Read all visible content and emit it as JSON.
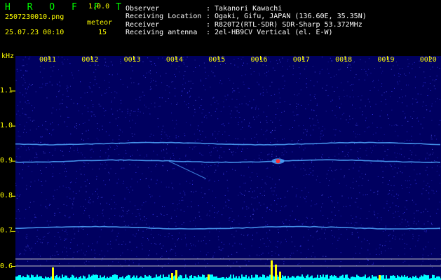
{
  "app": {
    "brand": "H R O F F T",
    "version": "1.0.0"
  },
  "file": {
    "filename": "2507230010.png",
    "datetime": "25.07.23 00:10"
  },
  "meteor": {
    "label": "meteor",
    "count": "15"
  },
  "station": {
    "rows": [
      {
        "key": "Observer",
        "sep": ":",
        "value": "Takanori Kawachi"
      },
      {
        "key": "Receiving Location",
        "sep": ":",
        "value": "Ogaki, Gifu, JAPAN (136.60E, 35.35N)"
      },
      {
        "key": "Receiver",
        "sep": ":",
        "value": "R820T2(RTL-SDR) SDR-Sharp 53.372MHz"
      },
      {
        "key": "Receiving antenna",
        "sep": ":",
        "value": "2el-HB9CV Vertical (el. E-W)"
      }
    ]
  },
  "axes": {
    "y_unit": "kHz",
    "y_ticks": [
      "1.1",
      "1.0",
      "0.9",
      "0.8",
      "0.7",
      "0.6"
    ],
    "x_ticks": [
      "0011",
      "0012",
      "0013",
      "0014",
      "0015",
      "0016",
      "0017",
      "0018",
      "0019",
      "0020"
    ]
  },
  "colors": {
    "background": "#000000",
    "plot_bg": "#000060",
    "noise": "#3a3aff",
    "trace": "#4fa8ff",
    "axis_text": "#ffff00",
    "histogram": "#00ffff",
    "histogram_peak": "#ffff00",
    "meteor_spot": "#ff3030",
    "brand": "#00ff00"
  },
  "signals": {
    "traces_khz": [
      0.95,
      0.9,
      0.71
    ],
    "meteor_time": "0016",
    "meteor_khz": 0.9
  }
}
